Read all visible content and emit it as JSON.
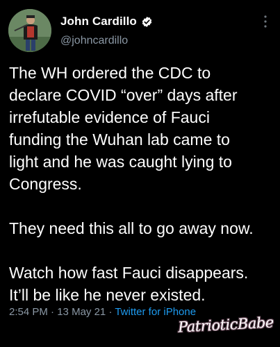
{
  "tweet": {
    "display_name": "John Cardillo",
    "handle": "@johncardillo",
    "text": "The WH ordered the CDC to\ndeclare COVID “over” days after\nirrefutable evidence of Fauci\nfunding the Wuhan lab came to\nlight and he was caught lying to\nCongress.\n\nThey need this all to go away now.\n\nWatch how fast Fauci disappears.\nIt’ll be like he never existed.",
    "time": "2:54 PM",
    "date": "13 May 21",
    "separator": "·",
    "source": "Twitter for iPhone"
  },
  "icons": {
    "avatar": "profile-photo",
    "verified": "verified-badge-icon",
    "more": "more-options-vertical-icon"
  },
  "watermark": "PatrioticBabe",
  "colors": {
    "background": "#000000",
    "text": "#ffffff",
    "secondary": "#8b98a5",
    "link": "#1d9bf0"
  }
}
